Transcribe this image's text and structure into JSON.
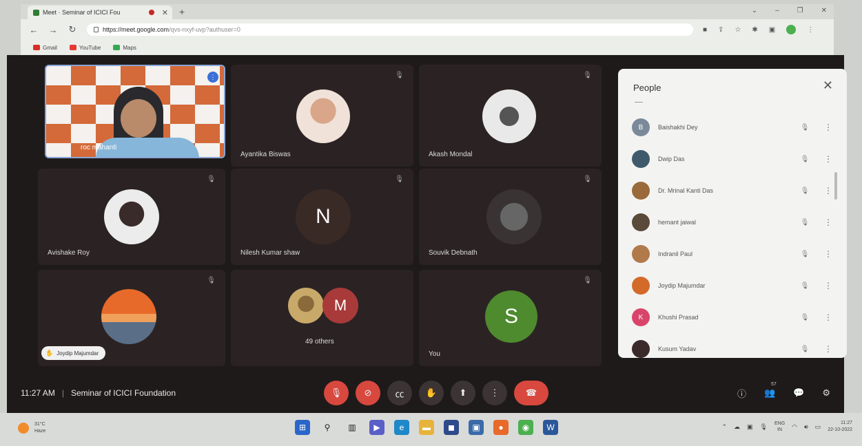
{
  "browser": {
    "tab_title": "Meet · Seminar of ICICI Fou",
    "tab_close": "✕",
    "new_tab": "+",
    "url_host": "https://meet.google.com",
    "url_rest": "/qvs-nxyf-uvp?authuser=0",
    "bookmarks": [
      {
        "label": "Gmail",
        "color": "#d93025"
      },
      {
        "label": "YouTube",
        "color": "#e53935"
      },
      {
        "label": "Maps",
        "color": "#34a853"
      }
    ]
  },
  "tiles": [
    {
      "name": "roc mahanti"
    },
    {
      "name": "Ayantika Biswas"
    },
    {
      "name": "Akash Mondal"
    },
    {
      "name": "Avishake Roy"
    },
    {
      "name": "Nilesh Kumar shaw",
      "letter": "N"
    },
    {
      "name": "Souvik Debnath"
    },
    {
      "name": ""
    },
    {
      "name": "49 others",
      "letter": "M"
    },
    {
      "name": "You",
      "letter": "S"
    }
  ],
  "hand_raised_chip": "Joydip Majumdar",
  "meeting": {
    "time": "11:27 AM",
    "separator": "|",
    "title": "Seminar of ICICI Foundation"
  },
  "people_panel": {
    "title": "People",
    "close": "✕",
    "participants": [
      {
        "name": "Baishakhi Dey",
        "initial": "B",
        "color": "#7a8a9a"
      },
      {
        "name": "Dwip Das",
        "initial": "",
        "color": "#3f5a6a"
      },
      {
        "name": "Dr. Mrinal Kanti Das",
        "initial": "",
        "color": "#9a6a3a"
      },
      {
        "name": "hemant jaiwal",
        "initial": "",
        "color": "#5a4a3a"
      },
      {
        "name": "Indranil Paul",
        "initial": "",
        "color": "#b07a4a"
      },
      {
        "name": "Joydip Majumdar",
        "initial": "",
        "color": "#d46a2a"
      },
      {
        "name": "Khushi Prasad",
        "initial": "K",
        "color": "#d9456a"
      },
      {
        "name": "Kusum Yadav",
        "initial": "",
        "color": "#3a2a2a"
      }
    ]
  },
  "people_count": "57",
  "taskbar": {
    "temp": "31°C",
    "condition": "Haze",
    "lang_top": "ENG",
    "lang_bottom": "IN",
    "time": "11:27",
    "date": "22-10-2022"
  }
}
